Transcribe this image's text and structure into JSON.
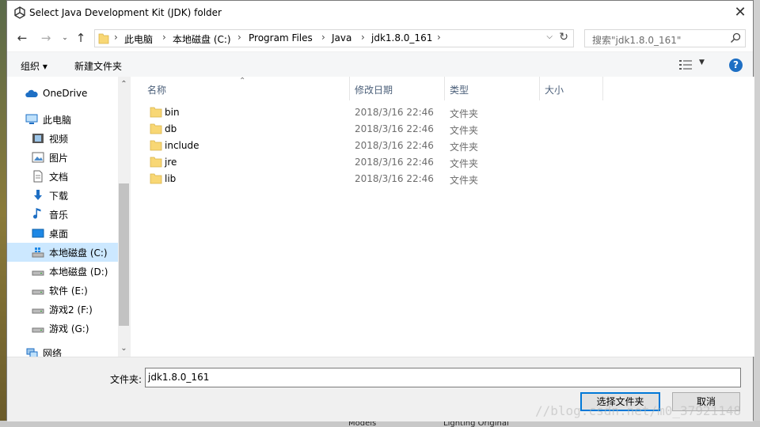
{
  "window": {
    "title": "Select Java Development Kit (JDK) folder",
    "close": "✕"
  },
  "address": {
    "crumbs": [
      "此电脑",
      "本地磁盘 (C:)",
      "Program Files",
      "Java",
      "jdk1.8.0_161"
    ],
    "search_placeholder": "搜索\"jdk1.8.0_161\""
  },
  "toolbar": {
    "organize": "组织 ▾",
    "new_folder": "新建文件夹",
    "help": "?"
  },
  "nav": {
    "onedrive": "OneDrive",
    "this_pc": "此电脑",
    "videos": "视频",
    "pictures": "图片",
    "documents": "文档",
    "downloads": "下载",
    "music": "音乐",
    "desktop": "桌面",
    "drive_c": "本地磁盘 (C:)",
    "drive_d": "本地磁盘 (D:)",
    "drive_e": "软件 (E:)",
    "drive_f": "游戏2 (F:)",
    "drive_g": "游戏 (G:)",
    "network": "网络"
  },
  "columns": {
    "name": "名称",
    "modified": "修改日期",
    "type": "类型",
    "size": "大小"
  },
  "files": [
    {
      "name": "bin",
      "modified": "2018/3/16 22:46",
      "type": "文件夹"
    },
    {
      "name": "db",
      "modified": "2018/3/16 22:46",
      "type": "文件夹"
    },
    {
      "name": "include",
      "modified": "2018/3/16 22:46",
      "type": "文件夹"
    },
    {
      "name": "jre",
      "modified": "2018/3/16 22:46",
      "type": "文件夹"
    },
    {
      "name": "lib",
      "modified": "2018/3/16 22:46",
      "type": "文件夹"
    }
  ],
  "bottom": {
    "folder_label": "文件夹:",
    "folder_value": "jdk1.8.0_161",
    "select_button": "选择文件夹",
    "cancel_button": "取消"
  },
  "background": {
    "tab1": "Models",
    "tab2": "Lighting  Original"
  },
  "watermark": "//blog.csdn.net/m0_37921148",
  "colors": {
    "accent": "#0078d7",
    "selection": "#cce8ff",
    "folder": "#f8d775",
    "help": "#1e6fc4"
  }
}
